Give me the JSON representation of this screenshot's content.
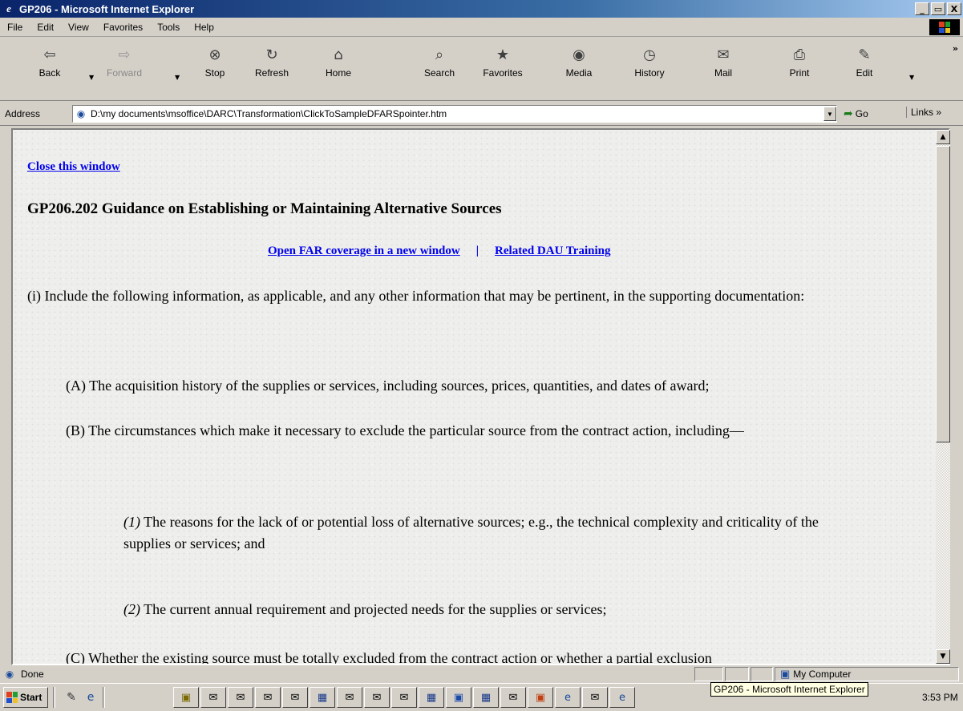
{
  "window": {
    "title": "GP206 - Microsoft Internet Explorer",
    "minimize": "_",
    "restore": "Ɖ",
    "close": "X"
  },
  "menu": [
    "File",
    "Edit",
    "View",
    "Favorites",
    "Tools",
    "Help"
  ],
  "toolbar": {
    "buttons": [
      {
        "label": "Back",
        "icon": "back-arrow-icon",
        "glyph": "⇦"
      },
      {
        "label": "Forward",
        "icon": "forward-arrow-icon",
        "glyph": "⇨",
        "disabled": true
      },
      {
        "label": "Stop",
        "icon": "stop-icon",
        "glyph": "⊗"
      },
      {
        "label": "Refresh",
        "icon": "refresh-icon",
        "glyph": "↻"
      },
      {
        "label": "Home",
        "icon": "home-icon",
        "glyph": "⌂"
      },
      {
        "label": "Search",
        "icon": "search-icon",
        "glyph": "⌕"
      },
      {
        "label": "Favorites",
        "icon": "favorites-icon",
        "glyph": "★"
      },
      {
        "label": "Media",
        "icon": "media-icon",
        "glyph": "◉"
      },
      {
        "label": "History",
        "icon": "history-icon",
        "glyph": "◷"
      },
      {
        "label": "Mail",
        "icon": "mail-icon",
        "glyph": "✉"
      },
      {
        "label": "Print",
        "icon": "print-icon",
        "glyph": "⎙"
      },
      {
        "label": "Edit",
        "icon": "edit-icon",
        "glyph": "✎"
      }
    ],
    "more": "»"
  },
  "address": {
    "label": "Address",
    "url": "D:\\my documents\\msoffice\\DARC\\Transformation\\ClickToSampleDFARSpointer.htm",
    "go_label": "Go",
    "links_label": "Links »"
  },
  "page": {
    "close_link": "Close this window",
    "heading": "GP206.202  Guidance on Establishing or Maintaining Alternative Sources",
    "link_far": "Open FAR coverage in a new window",
    "link_separator": "|",
    "link_training": "Related DAU Training",
    "para_i": "(i)  Include the following information, as applicable, and any other information that may be pertinent, in the supporting documentation:",
    "para_a": "(A)  The acquisition history of the supplies or services, including sources, prices, quantities, and dates of award;",
    "para_b": "(B)  The circumstances which make it necessary to exclude the particular source from the contract action, including—",
    "para_1_num": "(1)",
    "para_1_text": "  The reasons for the lack of or potential loss of alternative sources; e.g., the technical complexity and criticality of the supplies or services; and",
    "para_2_num": "(2)",
    "para_2_text": "  The current annual requirement and projected needs for the supplies or services;",
    "para_c": "(C)  Whether the existing source must be totally excluded from the contract action or whether a partial exclusion"
  },
  "status": {
    "text": "Done",
    "zone": "My Computer"
  },
  "taskbar": {
    "start_label": "Start",
    "tooltip": "GP206 - Microsoft Internet Explorer",
    "clock": "3:53 PM"
  },
  "colors": {
    "titlebar_start": "#0a246a",
    "link": "#0000ee",
    "chrome": "#d4d0c8"
  }
}
